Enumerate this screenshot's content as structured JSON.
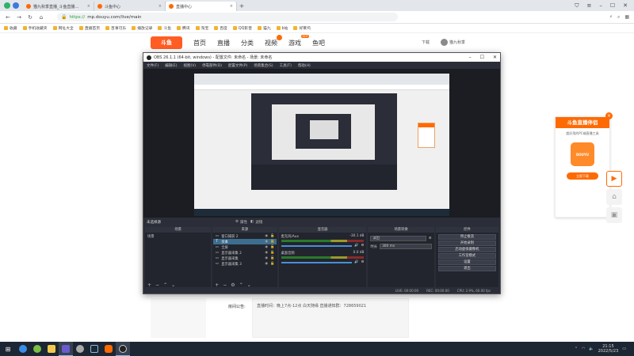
{
  "browser": {
    "tabs": [
      {
        "label": "猫九秋季直播_斗鱼直播…",
        "active": false
      },
      {
        "label": "斗鱼中心",
        "active": false
      },
      {
        "label": "直播中心",
        "active": true
      }
    ],
    "url_scheme": "https://",
    "url": "mp.douyu.com/live/main",
    "bookmarks": [
      "收藏",
      "手机收藏夹",
      "网址大全",
      "直播首页",
      "百事可乐",
      "播放记录",
      "斗鱼",
      "腾讯",
      "淘宝",
      "百度",
      "QQ影音",
      "猫九",
      "b站",
      "好莱坞"
    ]
  },
  "site": {
    "logo": "斗鱼",
    "nav": [
      "首页",
      "直播",
      "分类",
      "视频",
      "游戏",
      "鱼吧"
    ],
    "nav_right": [
      "下载",
      "猫九秋季"
    ],
    "notice_label": "房间公告:",
    "notice_text": "直播时间：晚上7点-12点 白天随缘 直播通知群：728659021"
  },
  "promo": {
    "title": "斗鱼直播伴侣",
    "subtitle": "超好用的PC端直播工具",
    "img_label": "DOUYU",
    "button": "立即下载",
    "close": "×"
  },
  "obs": {
    "title": "OBS 26.1.1 (64-bit, windows) - 配置文件: 未命名 - 场景: 未命名",
    "menu": [
      "文件(F)",
      "编辑(E)",
      "视图(V)",
      "停靠部件(D)",
      "配置文件(P)",
      "场景集合(S)",
      "工具(T)",
      "帮助(H)"
    ],
    "toolbar_label": "未选择源",
    "toolbar_buttons": [
      "属性",
      "滤镜"
    ],
    "docks": {
      "scenes": {
        "title": "场景",
        "items": [
          "场景"
        ]
      },
      "sources": {
        "title": "来源",
        "items": [
          "窗口捕获 2",
          "文本",
          "全屏",
          "显示器采集 2",
          "显示器采集",
          "显示器采集 3"
        ]
      },
      "mixer": {
        "title": "混音器",
        "channels": [
          {
            "name": "麦克风/Aux",
            "db": "-30.1 dB"
          },
          {
            "name": "桌面音频",
            "db": "0.0 dB"
          }
        ]
      },
      "transitions": {
        "title": "场景转换",
        "type": "淡出",
        "duration_label": "时长",
        "duration": "300 ms"
      },
      "controls": {
        "title": "控件",
        "buttons": [
          "停止推流",
          "开始录制",
          "启动虚拟摄像机",
          "工作室模式",
          "设置",
          "退出"
        ]
      }
    },
    "status": [
      "LIVE: 00:00:00",
      "REC: 00:00:00",
      "CPU: 2.9%, 60.00 fps"
    ]
  },
  "taskbar": {
    "time": "21:15",
    "date": "2022/5/23"
  },
  "colors": {
    "accent": "#ff6a00",
    "obs_bg": "#2b2e38",
    "selection": "#3d6e8f"
  }
}
